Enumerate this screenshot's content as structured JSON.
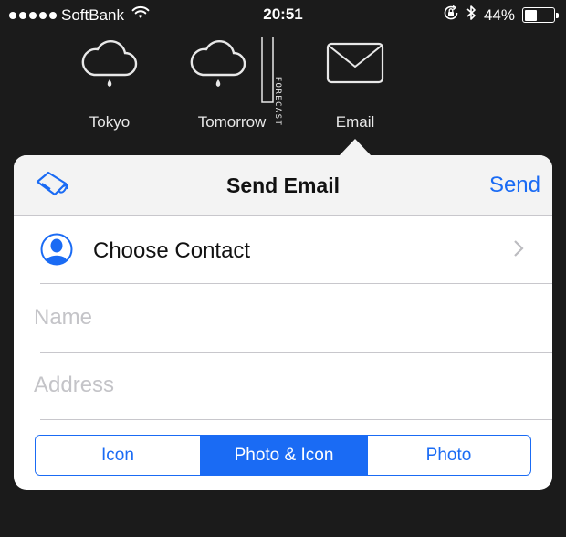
{
  "status_bar": {
    "signal_dots": 5,
    "carrier": "SoftBank",
    "time": "20:51",
    "battery_text": "44%",
    "battery_level": 0.44
  },
  "shortcuts": [
    {
      "label": "Tokyo",
      "icon": "cloud-rain-icon"
    },
    {
      "label": "Tomorrow",
      "icon": "cloud-rain-forecast-icon",
      "badge_text": "FORECAST"
    },
    {
      "label": "Email",
      "icon": "envelope-icon"
    }
  ],
  "popover": {
    "title": "Send Email",
    "send_label": "Send",
    "left_icon": "tag-arrow-icon",
    "contact_label": "Choose Contact",
    "name_placeholder": "Name",
    "address_placeholder": "Address",
    "segments": [
      "Icon",
      "Photo & Icon",
      "Photo"
    ],
    "selected_segment": "Photo & Icon"
  },
  "colors": {
    "accent": "#1a6bf4",
    "background": "#1b1b1b",
    "navbar": "#f3f3f3",
    "placeholder": "#c4c4c8"
  }
}
